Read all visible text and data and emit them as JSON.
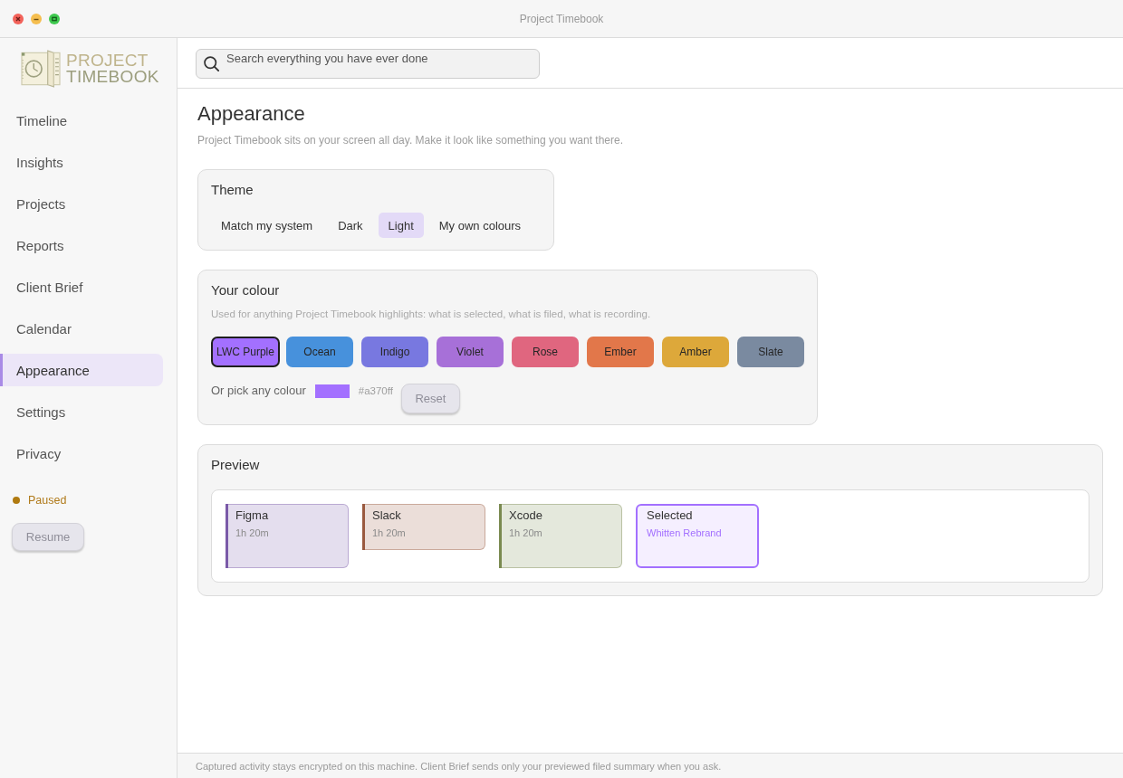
{
  "window": {
    "title": "Project Timebook"
  },
  "sidebar": {
    "logo": {
      "line_1": "PROJECT",
      "line_2": "TIMEBOOK"
    },
    "items": [
      {
        "label": "Timeline",
        "selected": false
      },
      {
        "label": "Insights",
        "selected": false
      },
      {
        "label": "Projects",
        "selected": false
      },
      {
        "label": "Reports",
        "selected": false
      },
      {
        "label": "Client Brief",
        "selected": false
      },
      {
        "label": "Calendar",
        "selected": false
      },
      {
        "label": "Appearance",
        "selected": true
      },
      {
        "label": "Settings",
        "selected": false
      },
      {
        "label": "Privacy",
        "selected": false
      }
    ],
    "status": {
      "label": "Paused"
    },
    "resume_button": {
      "label": "Resume",
      "disabled": true
    }
  },
  "search": {
    "placeholder": "Search everything you have ever done"
  },
  "page": {
    "title": "Appearance",
    "subtitle": "Project Timebook sits on your screen all day. Make it look like something you want there."
  },
  "theme": {
    "title": "Theme",
    "options": [
      {
        "label": "Match my system",
        "selected": false
      },
      {
        "label": "Dark",
        "selected": false
      },
      {
        "label": "Light",
        "selected": true
      },
      {
        "label": "My own colours",
        "selected": false
      }
    ]
  },
  "colour": {
    "title": "Your colour",
    "description": "Used for anything Project Timebook highlights: what is selected, what is filed, what is recording.",
    "swatches": [
      {
        "label": "LWC Purple",
        "color": "#a370ff",
        "selected": true
      },
      {
        "label": "Ocean",
        "color": "#4791dc",
        "selected": false
      },
      {
        "label": "Indigo",
        "color": "#7878e0",
        "selected": false
      },
      {
        "label": "Violet",
        "color": "#a770d8",
        "selected": false
      },
      {
        "label": "Rose",
        "color": "#e0667f",
        "selected": false
      },
      {
        "label": "Ember",
        "color": "#e2774a",
        "selected": false
      },
      {
        "label": "Amber",
        "color": "#dda83a",
        "selected": false
      },
      {
        "label": "Slate",
        "color": "#7a8aa0",
        "selected": false
      }
    ],
    "custom": {
      "label": "Or pick any colour",
      "color": "#a370ff",
      "value": "#a370ff"
    },
    "reset_button": {
      "label": "Reset",
      "disabled": true
    }
  },
  "preview": {
    "title": "Preview",
    "cards": [
      {
        "title": "Figma",
        "detail": "1h 20m",
        "color": "#7a5aa8",
        "compact": false,
        "selected": false
      },
      {
        "title": "Slack",
        "detail": "1h 20m",
        "color": "#9a5a40",
        "compact": true,
        "selected": false
      },
      {
        "title": "Xcode",
        "detail": "1h 20m",
        "color": "#7a8a50",
        "compact": false,
        "selected": false
      },
      {
        "title": "Selected",
        "detail": "Whitten Rebrand",
        "color": "#a370ff",
        "compact": false,
        "selected": true
      }
    ]
  },
  "status_bar": {
    "text": "Captured activity stays encrypted on this machine. Client Brief sends only your previewed filed summary when you ask."
  }
}
